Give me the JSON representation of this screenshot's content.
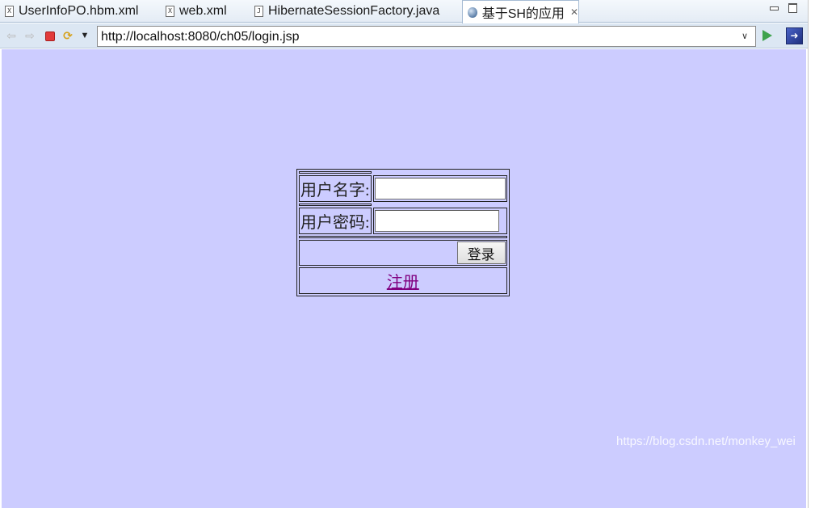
{
  "tabs": [
    {
      "label": "UserInfoPO.hbm.xml",
      "icon": "xml-file-icon"
    },
    {
      "label": "web.xml",
      "icon": "xml-file-icon"
    },
    {
      "label": "HibernateSessionFactory.java",
      "icon": "java-file-icon"
    },
    {
      "label": "基于SH的应用",
      "icon": "globe-icon",
      "active": true
    }
  ],
  "nav": {
    "url": "http://localhost:8080/ch05/login.jsp"
  },
  "form": {
    "username_label": "用户名字:",
    "password_label": "用户密码:",
    "username_value": "",
    "password_value": "",
    "login_button": "登录",
    "register_link": "注册"
  },
  "watermark": "https://blog.csdn.net/monkey_wei",
  "colors": {
    "page_background": "#ccccff",
    "link_visited": "#800080"
  }
}
